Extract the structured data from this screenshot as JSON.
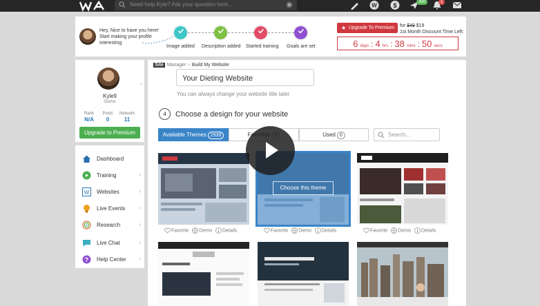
{
  "topbar": {
    "search_placeholder": "Need help Kyle? Ask your question here...",
    "badge_plane": "300",
    "badge_bell": "1"
  },
  "progress": {
    "greeting": "Hey, Nice to have you here! Start making your profile interesting",
    "steps": [
      {
        "label": "Image added",
        "color": "#3ec6c6",
        "icon": "check-icon"
      },
      {
        "label": "Description added",
        "color": "#7dc142",
        "icon": "check-icon"
      },
      {
        "label": "Started training",
        "color": "#e24b68",
        "icon": "check-icon"
      },
      {
        "label": "Goals are set",
        "color": "#8e4fd0",
        "icon": "check-icon"
      }
    ],
    "upgrade_label": "Upgrade To Premium",
    "promo_for": "for",
    "old_price": "$49",
    "new_price": "$19",
    "promo_note": "1st Month Discount Time Left:",
    "timer": {
      "days": "6",
      "days_unit": "days",
      "hours": "4",
      "hours_unit": "hrs",
      "mins": "38",
      "mins_unit": "mins",
      "secs": "50",
      "secs_unit": "secs"
    }
  },
  "profile": {
    "name": "Kyle9",
    "role": "Starter",
    "stats": [
      {
        "label": "Rank",
        "value": "N/A"
      },
      {
        "label": "Posts",
        "value": "0"
      },
      {
        "label": "Network",
        "value": "11"
      }
    ],
    "upgrade_label": "Upgrade to Premium"
  },
  "nav": {
    "items": [
      {
        "label": "Dashboard",
        "icon": "home-icon",
        "color": "#2a6fb0"
      },
      {
        "label": "Training",
        "icon": "play-circle-icon",
        "color": "#4caf50"
      },
      {
        "label": "Websites",
        "icon": "wordpress-icon",
        "color": "#2a7ab8"
      },
      {
        "label": "Live Events",
        "icon": "lightbulb-icon",
        "color": "#f0a020"
      },
      {
        "label": "Research",
        "icon": "fingerprint-icon",
        "color": "#e07030"
      },
      {
        "label": "Live Chat",
        "icon": "chat-icon",
        "color": "#3ab0c0"
      },
      {
        "label": "Help Center",
        "icon": "question-icon",
        "color": "#8e4fd0"
      }
    ]
  },
  "main": {
    "breadcrumb": {
      "site": "Site",
      "manager": "Manager",
      "sep": "›",
      "current": "Build My Website"
    },
    "site_title_value": "Your Dieting Website",
    "site_title_hint": "You can always change your website title later",
    "step_number": "4",
    "step_title": "Choose a design for your website",
    "tabs": [
      {
        "label": "Available Themes",
        "count": "2939"
      },
      {
        "label": "Favorites",
        "count": "0"
      },
      {
        "label": "Used",
        "count": "0"
      }
    ],
    "theme_search_placeholder": "Search...",
    "choose_theme_label": "Choose this theme",
    "actions": {
      "favorite": "Favorite",
      "demo": "Demo",
      "details": "Details"
    }
  }
}
